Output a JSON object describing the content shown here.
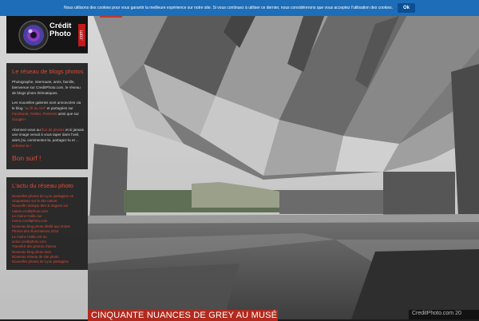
{
  "cookie_bar": {
    "text": "Nous utilisons des cookies pour vous garantir la meilleure expérience sur notre site. Si vous continuez à utiliser ce dernier, nous considérerons que vous acceptez l'utilisation des cookies.",
    "ok_label": "Ok",
    "color": "#1d6db8"
  },
  "logo": {
    "line1": "Crédit",
    "line2": "Photo",
    "suffix": ".com"
  },
  "about_panel": {
    "title": "Le réseau de blogs photos",
    "p1": "Photographe, internaute, amis, famille, bienvenue sur CreditPhoto.com, le réseau de blogs photo thématiques.",
    "p2_a": "Les nouvelles galeries sont annoncées via le blog ",
    "p2_link": "\"au fil du ciel\"",
    "p2_b": " et partagées sur ",
    "p2_links": "Facebook, Twitter, Pinterest",
    "p2_c": " ainsi que sur ",
    "p2_google": "Google+.",
    "p3_a": "Abonnez-vous au ",
    "p3_link": "flux de photos",
    "p3_b": " et si jamais une image venait à vous taper dans l'oeil, alors j'ai, commentez-la, partagez-la et ... ",
    "p3_link2": "achetez-la !",
    "bon_surf": "Bon surf !"
  },
  "news_panel": {
    "title": "L'actu du réseau photo",
    "items": [
      "Nouvelles photos de Lyon partagées en ",
      "cinquanteur sur le site nature",
      "Nouvelle rubrique Mer & Vagues sur",
      "nature.creditphoto.com",
      "Le moine Haiku sur",
      "moine.creditphoto.com",
      "Nouveau blog photo dédié aux motos",
      "Photos des Illuminations 2014",
      "Le moine Haiku est au",
      "actus.creditphoto.com",
      "Transfert des photos d'actus",
      "Nouveau blog photo auto",
      "Nouveau réseau de site photo",
      "Nouvelles photos de Lyon partagées"
    ]
  },
  "article": {
    "title": "CINQUANTE NUANCES DE GREY AU MUSÉE DES CONFLUENCES"
  },
  "credit": {
    "text": "CreditPhoto.com 20"
  },
  "colors": {
    "accent": "#e04a35",
    "banner": "#b22a1e",
    "panel_bg": "#181818"
  }
}
